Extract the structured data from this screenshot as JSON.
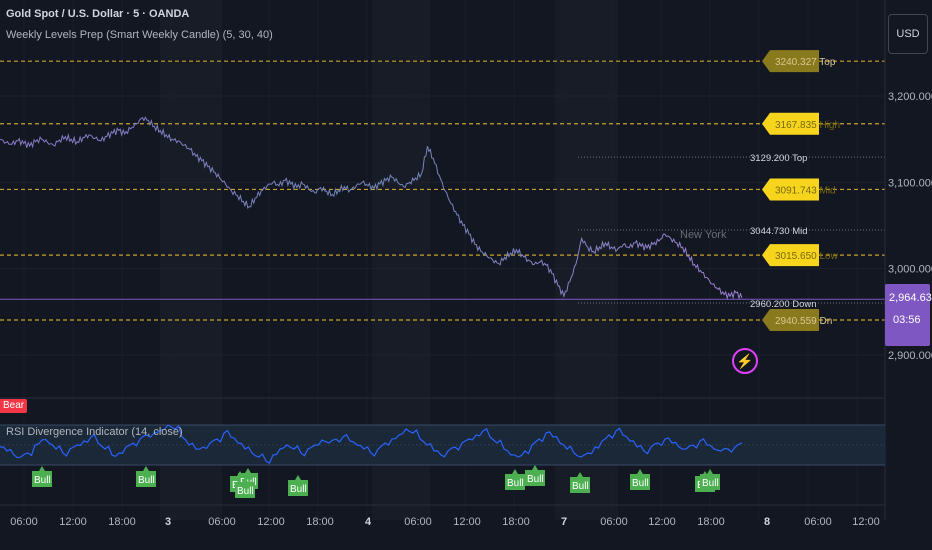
{
  "header": {
    "symbol": "Gold Spot / U.S. Dollar · 5 · OANDA",
    "indicator": "Weekly Levels Prep (Smart Weekly Candle) (5, 30, 40)"
  },
  "currency": "USD",
  "current": {
    "price": "2,964.635",
    "countdown": "03:56"
  },
  "rsi_title": "RSI Divergence Indicator (14, close)",
  "bear_label": "Bear",
  "chart_data": [
    {
      "type": "line",
      "title": "Gold Spot / U.S. Dollar · 5 · OANDA",
      "x_ticks": [
        "06:00",
        "12:00",
        "18:00",
        "3",
        "06:00",
        "12:00",
        "18:00",
        "4",
        "06:00",
        "12:00",
        "18:00",
        "7",
        "06:00",
        "12:00",
        "18:00",
        "8",
        "06:00",
        "12:00"
      ],
      "y_ticks": [
        3200,
        3100,
        3000,
        2900
      ],
      "y_tick_labels": [
        "3,200.000",
        "3,100.000",
        "3,000.000",
        "2,900.000"
      ],
      "ylim": [
        2870,
        3290
      ],
      "series": [
        {
          "values": [
            3150,
            3146,
            3144,
            3148,
            3145,
            3142,
            3147,
            3150,
            3146,
            3143,
            3149,
            3153,
            3150,
            3147,
            3152,
            3155,
            3151,
            3148,
            3153,
            3157,
            3160,
            3156,
            3162,
            3168,
            3175,
            3172,
            3165,
            3160,
            3155,
            3150,
            3148,
            3143,
            3138,
            3130,
            3125,
            3118,
            3112,
            3105,
            3098,
            3090,
            3085,
            3078,
            3072,
            3082,
            3090,
            3096,
            3100,
            3096,
            3102,
            3098,
            3094,
            3098,
            3092,
            3088,
            3094,
            3090,
            3086,
            3091,
            3095,
            3091,
            3096,
            3100,
            3096,
            3093,
            3098,
            3102,
            3106,
            3100,
            3095,
            3100,
            3105,
            3110,
            3142,
            3128,
            3108,
            3090,
            3075,
            3062,
            3050,
            3040,
            3028,
            3020,
            3015,
            3010,
            3006,
            3013,
            3018,
            3022,
            3016,
            3010,
            3005,
            3008,
            3004,
            2994,
            2980,
            2968,
            2985,
            3005,
            3035,
            3025,
            3020,
            3025,
            3030,
            3025,
            3022,
            3028,
            3024,
            3030,
            3026,
            3024,
            3028,
            3032,
            3040,
            3035,
            3030,
            3025,
            3015,
            3005,
            2998,
            2990,
            2982,
            2976,
            2970,
            2968,
            2972,
            2966
          ]
        }
      ],
      "levels": [
        {
          "label": "3240.327 Top",
          "value": 3240.327
        },
        {
          "label": "3167.835 High",
          "value": 3167.835
        },
        {
          "label": "3129.200 Top",
          "value": 3129.2
        },
        {
          "label": "3091.743 Mid",
          "value": 3091.743
        },
        {
          "label": "3044.730 Mid",
          "value": 3044.73
        },
        {
          "label": "3015.650 Low",
          "value": 3015.65
        },
        {
          "label": "2960.200 Down",
          "value": 2960.2
        },
        {
          "label": "2940.559 Dn",
          "value": 2940.559
        }
      ],
      "annotation": "New York"
    },
    {
      "type": "line",
      "title": "RSI Divergence Indicator (14, close)",
      "ylim": [
        20,
        80
      ],
      "band": [
        30,
        70
      ],
      "midline": 50,
      "series": [
        {
          "values": [
            48,
            44,
            40,
            38,
            42,
            50,
            55,
            52,
            46,
            42,
            46,
            50,
            54,
            58,
            52,
            46,
            40,
            42,
            48,
            52,
            56,
            60,
            62,
            65,
            70,
            66,
            58,
            50,
            46,
            48,
            52,
            56,
            62,
            58,
            52,
            46,
            42,
            38,
            34,
            40,
            46,
            50,
            46,
            42,
            46,
            50,
            55,
            52,
            56,
            58,
            54,
            50,
            46,
            42,
            46,
            52,
            56,
            60,
            66,
            62,
            56,
            50,
            44,
            40,
            44,
            48,
            52,
            56,
            60,
            64,
            58,
            52,
            46,
            40,
            38,
            44,
            50,
            56,
            62,
            58,
            52,
            46,
            42,
            38,
            42,
            48,
            54,
            60,
            64,
            60,
            54,
            48,
            44,
            48,
            52,
            56,
            52,
            48,
            46,
            50,
            54,
            50,
            46,
            44,
            46,
            48,
            52
          ]
        }
      ],
      "signals": [
        "Bull",
        "Bull",
        "Bull",
        "Bull",
        "Bull",
        "Bull",
        "Bull",
        "Bull",
        "Bull",
        "Bull",
        "Bull",
        "Bull"
      ]
    }
  ]
}
